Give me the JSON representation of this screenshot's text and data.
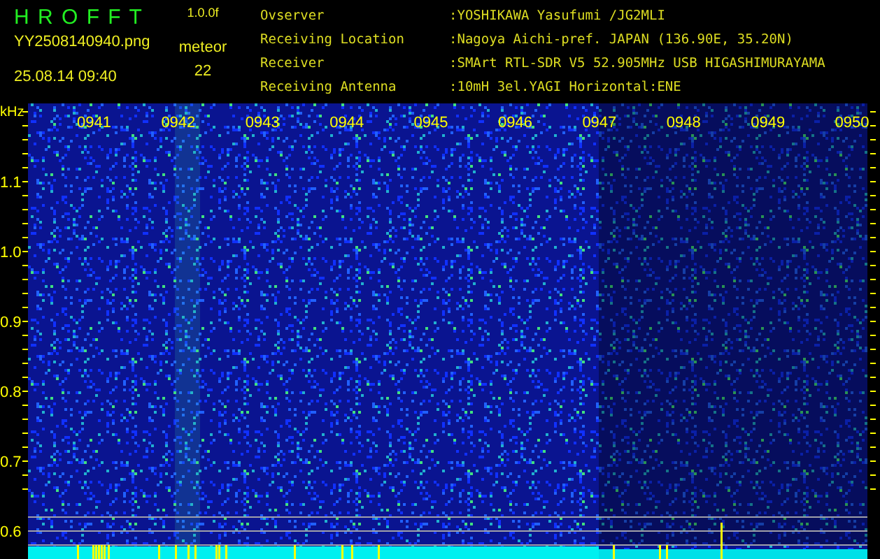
{
  "header": {
    "program": "H R O F F T",
    "version": "1.0.0f",
    "file": "YY2508140940.png",
    "mode": "meteor",
    "timestamp": "25.08.14 09:40",
    "count": "22",
    "info": [
      {
        "label": "Ovserver",
        "value": ":YOSHIKAWA Yasufumi /JG2MLI"
      },
      {
        "label": "Receiving Location",
        "value": ":Nagoya Aichi-pref. JAPAN (136.90E, 35.20N)"
      },
      {
        "label": "Receiver",
        "value": ":SMArt RTL-SDR V5 52.905MHz USB HIGASHIMURAYAMA"
      },
      {
        "label": "Receiving Antenna",
        "value": ":10mH 3el.YAGI Horizontal:ENE"
      }
    ]
  },
  "spectrogram": {
    "unit": "kHz",
    "frequency_ticks": [
      "1.1",
      "1.0",
      "0.9",
      "0.8",
      "0.7",
      "0.6"
    ],
    "time_marks": [
      "0941",
      "0942",
      "0943",
      "0944",
      "0945",
      "0946",
      "0947",
      "0948",
      "0949",
      "0950"
    ]
  }
}
